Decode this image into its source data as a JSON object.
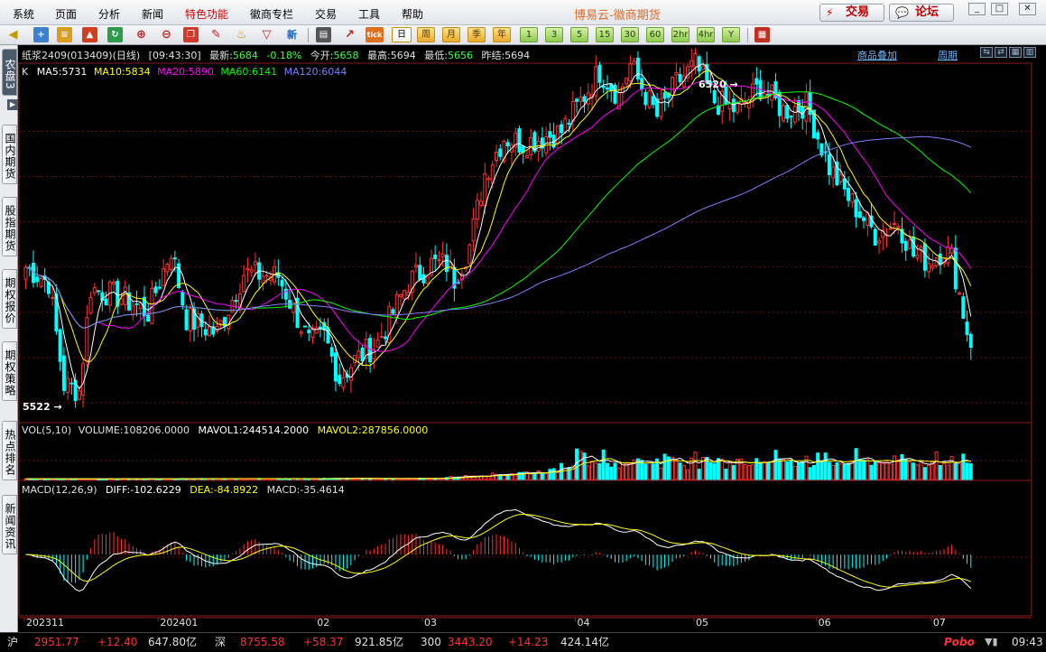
{
  "menubar": {
    "items": [
      "系统",
      "页面",
      "分析",
      "新闻",
      "特色功能",
      "徽商专栏",
      "交易",
      "工具",
      "帮助"
    ],
    "brand": "博易云-徽商期货",
    "trade_button": "交易",
    "forum_button": "论坛",
    "window_buttons": [
      "_",
      "□",
      "✕"
    ]
  },
  "toolbar": {
    "icons": [
      "back-icon",
      "cross-icon",
      "db-icon",
      "rise-icon",
      "refresh-icon",
      "zoom-in-icon",
      "zoom-out-icon",
      "window-icon",
      "draw-icon",
      "bell-icon",
      "filter-icon",
      "new-icon",
      "list-icon",
      "chart-icon",
      "tick-icon"
    ],
    "new_label": "新",
    "tick_label": "tick",
    "periods": [
      "日",
      "周",
      "月",
      "季",
      "年",
      "1",
      "3",
      "5",
      "15",
      "30",
      "60",
      "2hr",
      "4hr",
      "Y"
    ],
    "selected_period": "日"
  },
  "sidebar": {
    "tabs": [
      "农盘3",
      "国内期货",
      "股指期货",
      "期权报价",
      "期权策略",
      "热点排名",
      "新闻资讯"
    ]
  },
  "infobar": {
    "name": "纸浆2409(013409)(日线)",
    "time": "[09:43:30]",
    "latest_label": "最新:",
    "latest_value": "5684",
    "change": "-0.18%",
    "open_label": "今开:",
    "open_value": "5658",
    "high_label": "最高:",
    "high_value": "5694",
    "low_label": "最低:",
    "low_value": "5656",
    "prev_label": "昨结:",
    "prev_value": "5694",
    "overlay_link": "商品叠加",
    "period_link": "周期"
  },
  "ma_legend": {
    "k": "K",
    "ma5": "MA5:5731",
    "ma10": "MA10:5834",
    "ma20": "MA20:5890",
    "ma60": "MA60:6141",
    "ma120": "MA120:6044"
  },
  "annotations": {
    "high_label": "6520",
    "low_label": "5522"
  },
  "volume": {
    "title": "VOL(5,10)",
    "volume": "VOLUME:108206.0000",
    "mavol1": "MAVOL1:244514.2000",
    "mavol2": "MAVOL2:287856.0000"
  },
  "macd": {
    "title": "MACD(12,26,9)",
    "diff": "DIFF:-102.6229",
    "dea": "DEA:-84.8922",
    "macd": "MACD:-35.4614"
  },
  "date_axis": [
    {
      "label": "202311",
      "idx": 0
    },
    {
      "label": "202401",
      "idx": 35
    },
    {
      "label": "02",
      "idx": 76
    },
    {
      "label": "03",
      "idx": 104
    },
    {
      "label": "04",
      "idx": 144
    },
    {
      "label": "05",
      "idx": 175
    },
    {
      "label": "06",
      "idx": 207
    },
    {
      "label": "07",
      "idx": 237
    }
  ],
  "colors": {
    "up": "#ff3232",
    "down": "#00ffff",
    "ma5": "#ffffff",
    "ma10": "#ffff00",
    "ma20": "#ff00ff",
    "ma60": "#00ff00",
    "ma120": "#7f7fff"
  },
  "chart_data": {
    "type": "candlestick",
    "candle_count": 248,
    "price_keys": [
      [
        0,
        5950
      ],
      [
        6,
        5900
      ],
      [
        10,
        5560
      ],
      [
        14,
        5540
      ],
      [
        17,
        5880
      ],
      [
        25,
        5850
      ],
      [
        32,
        5800
      ],
      [
        38,
        6010
      ],
      [
        42,
        5780
      ],
      [
        50,
        5730
      ],
      [
        57,
        5930
      ],
      [
        66,
        5920
      ],
      [
        74,
        5700
      ],
      [
        78,
        5720
      ],
      [
        82,
        5580
      ],
      [
        86,
        5640
      ],
      [
        92,
        5700
      ],
      [
        100,
        5900
      ],
      [
        106,
        5960
      ],
      [
        110,
        5960
      ],
      [
        112,
        5910
      ],
      [
        116,
        6020
      ],
      [
        120,
        6260
      ],
      [
        125,
        6380
      ],
      [
        130,
        6360
      ],
      [
        140,
        6400
      ],
      [
        150,
        6600
      ],
      [
        155,
        6520
      ],
      [
        158,
        6620
      ],
      [
        165,
        6450
      ],
      [
        170,
        6560
      ],
      [
        175,
        6620
      ],
      [
        180,
        6500
      ],
      [
        186,
        6470
      ],
      [
        192,
        6550
      ],
      [
        198,
        6470
      ],
      [
        204,
        6490
      ],
      [
        210,
        6280
      ],
      [
        215,
        6180
      ],
      [
        222,
        6060
      ],
      [
        228,
        6100
      ],
      [
        232,
        5990
      ],
      [
        236,
        5970
      ],
      [
        240,
        6010
      ],
      [
        242,
        5980
      ],
      [
        244,
        5860
      ],
      [
        246,
        5740
      ],
      [
        247,
        5684
      ]
    ],
    "high": 6520,
    "low": 5522,
    "ylim": [
      5440,
      6620
    ],
    "volume_ylim": [
      0,
      520000
    ],
    "macd_ylim": [
      -180,
      170
    ]
  },
  "status": {
    "sh_label": "沪",
    "sh_index": "2951.77",
    "sh_change": "+12.40",
    "sh_amount": "647.80亿",
    "sz_label": "深",
    "sz_index": "8755.58",
    "sz_change": "+58.37",
    "sz_amount": "921.85亿",
    "i300_label": "300",
    "i300_index": "3443.20",
    "i300_change": "+14.23",
    "i300_amount": "424.14亿",
    "brand": "Pobo",
    "time": "09:43"
  }
}
